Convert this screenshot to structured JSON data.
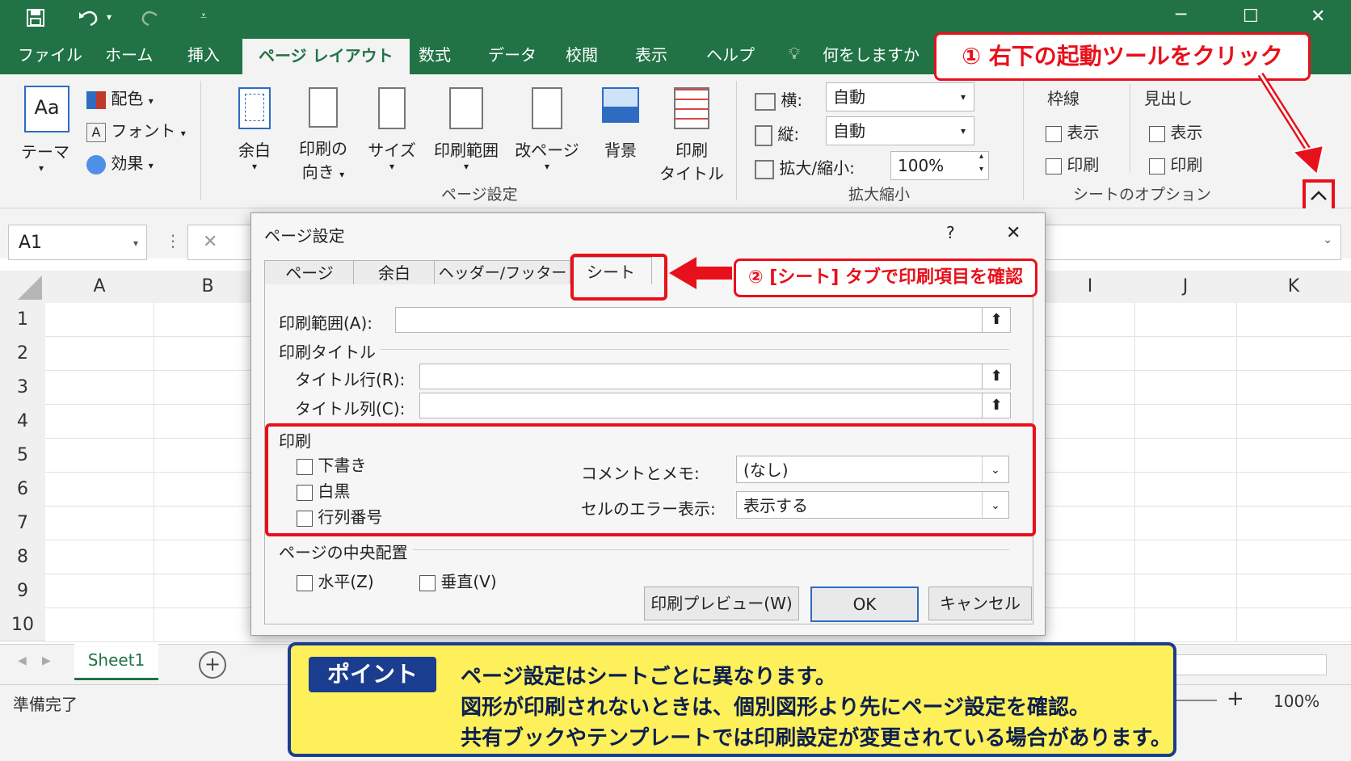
{
  "titlebar": {
    "save_icon": "save-icon",
    "undo_icon": "undo-icon",
    "redo_icon": "redo-icon",
    "customize_icon": "chevron-down-icon",
    "minimize": "─",
    "maximize": "☐",
    "close": "✕"
  },
  "tabs": [
    "ファイル",
    "ホーム",
    "挿入",
    "ページ レイアウト",
    "数式",
    "データ",
    "校閲",
    "表示",
    "ヘルプ"
  ],
  "tell_me": "何をしますか",
  "ribbon": {
    "theme": {
      "icon_text": "Aa",
      "label": "テーマ",
      "colors": "配色",
      "fonts": "フォント",
      "effects": "効果"
    },
    "page_setup": {
      "margins": "余白",
      "orientation_1": "印刷の",
      "orientation_2": "向き",
      "size": "サイズ",
      "print_area": "印刷範囲",
      "breaks": "改ページ",
      "background": "背景",
      "print_titles_1": "印刷",
      "print_titles_2": "タイトル",
      "group": "ページ設定"
    },
    "scale": {
      "width_label": "横:",
      "width_value": "自動",
      "height_label": "縦:",
      "height_value": "自動",
      "zoom_label": "拡大/縮小:",
      "zoom_value": "100%",
      "group": "拡大縮小"
    },
    "sheet_options": {
      "gridlines": "枠線",
      "headings": "見出し",
      "view": "表示",
      "print": "印刷",
      "group": "シートのオプション"
    }
  },
  "callout1": "① 右下の起動ツールをクリック",
  "formula": {
    "namebox": "A1",
    "cancel": "✕"
  },
  "columns": [
    "A",
    "B",
    "I",
    "J",
    "K"
  ],
  "rows": [
    "1",
    "2",
    "3",
    "4",
    "5",
    "6",
    "7",
    "8",
    "9",
    "10"
  ],
  "sheet_tab": "Sheet1",
  "add_sheet": "+",
  "status": {
    "ready": "準備完了",
    "zoom_plus": "+",
    "zoom": "100%"
  },
  "dialog": {
    "title": "ページ設定",
    "help": "?",
    "close": "✕",
    "tabs": [
      "ページ",
      "余白",
      "ヘッダー/フッター",
      "シート"
    ],
    "print_area_label": "印刷範囲(A):",
    "print_titles_label": "印刷タイトル",
    "title_rows_label": "タイトル行(R):",
    "title_cols_label": "タイトル列(C):",
    "print_label": "印刷",
    "draft": "下書き",
    "bw": "白黒",
    "row_col_headings": "行列番号",
    "comments_label": "コメントとメモ:",
    "comments_value": "(なし)",
    "errors_label": "セルのエラー表示:",
    "errors_value": "表示する",
    "center_label": "ページの中央配置",
    "horizontal": "水平(Z)",
    "vertical": "垂直(V)",
    "preview_btn": "印刷プレビュー(W)",
    "ok_btn": "OK",
    "cancel_btn": "キャンセル"
  },
  "callout2": "② [シート] タブで印刷項目を確認",
  "point": {
    "badge": "ポイント",
    "lines": [
      "ページ設定はシートごとに異なります。",
      "図形が印刷されないときは、個別図形より先にページ設定を確認。",
      "共有ブックやテンプレートでは印刷設定が変更されている場合があります。"
    ]
  },
  "colors": {
    "excel_green": "#217346",
    "red": "#e8101a",
    "point_bg": "#fdf05a",
    "point_border": "#1a3d8f"
  }
}
